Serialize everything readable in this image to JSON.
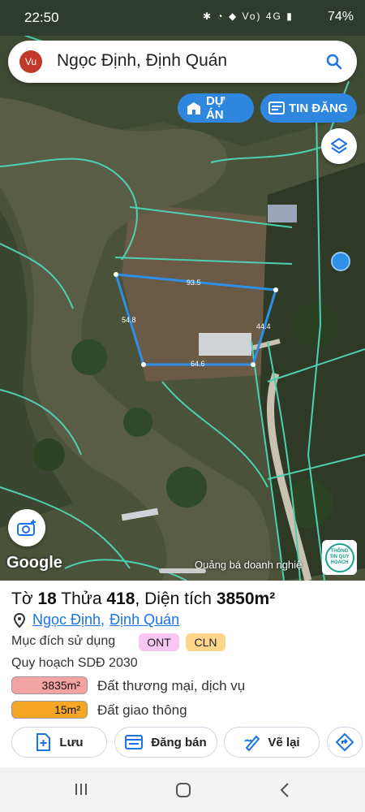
{
  "status_bar": {
    "time": "22:50",
    "icons": "✱ ◔ ◆ Vo) 4G ▮",
    "network": "LTE1",
    "battery": "74%"
  },
  "search": {
    "avatar": "Vu",
    "query": "Ngọc Định, Định Quán",
    "icon": "search-icon"
  },
  "pills": {
    "du_an": "DỰ ÁN",
    "tin_dang": "TIN ĐĂNG"
  },
  "map": {
    "dimensions": [
      "93.5",
      "54.8",
      "44.4",
      "64.6"
    ],
    "google": "Google",
    "promo": "Quảng bá doanh nghiệ",
    "planning_badge": "THÔNG TIN QUY HOẠCH"
  },
  "sheet": {
    "title_prefix": "Tờ",
    "sheet_no": "18",
    "parcel_label": "Thửa",
    "parcel_no": "418",
    "area_label": ", Diện tích",
    "area_value": "3850m²",
    "location_1": "Ngọc Định",
    "location_sep": ",",
    "location_2": "Định Quán",
    "usage_label": "Mục đích sử dụng",
    "usage_tags": [
      "ONT",
      "CLN"
    ],
    "planning_label": "Quy hoạch SDĐ 2030",
    "planning_rows": [
      {
        "area": "3835m²",
        "label": "Đất thương mại, dịch vụ",
        "color": "#f4a3a3"
      },
      {
        "area": "15m²",
        "label": "Đất giao thông",
        "color": "#f5a623"
      }
    ]
  },
  "actions": {
    "save": "Lưu",
    "post_sale": "Đăng bán",
    "redraw": "Vẽ lại"
  },
  "colors": {
    "accent": "#2e86de",
    "parcel_line": "#2f8fe6",
    "boundary": "#4dd0b0"
  }
}
